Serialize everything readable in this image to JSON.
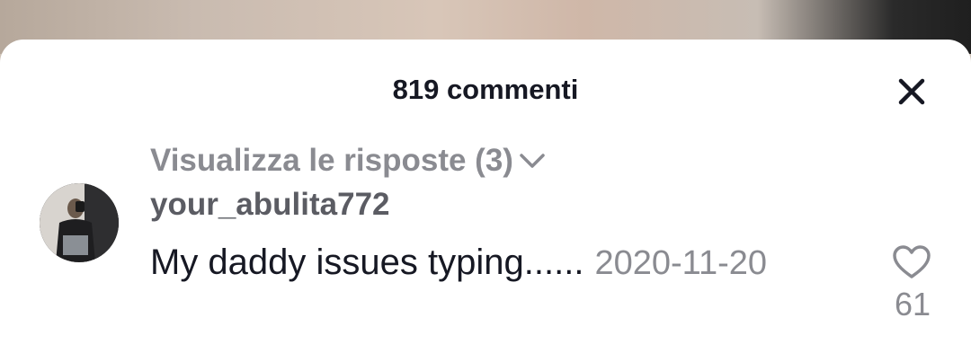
{
  "header": {
    "title": "819 commenti",
    "close_icon": "close-icon"
  },
  "replies": {
    "label": "Visualizza le risposte (3)",
    "icon": "chevron-down-icon"
  },
  "comment": {
    "username": "your_abulita772",
    "text": "My daddy issues typing......",
    "date": "2020-11-20",
    "likes": "61",
    "like_icon": "heart-outline-icon"
  },
  "colors": {
    "title": "#161823",
    "muted": "#8a8b91",
    "username": "#5b5c63",
    "sheet": "#ffffff"
  }
}
